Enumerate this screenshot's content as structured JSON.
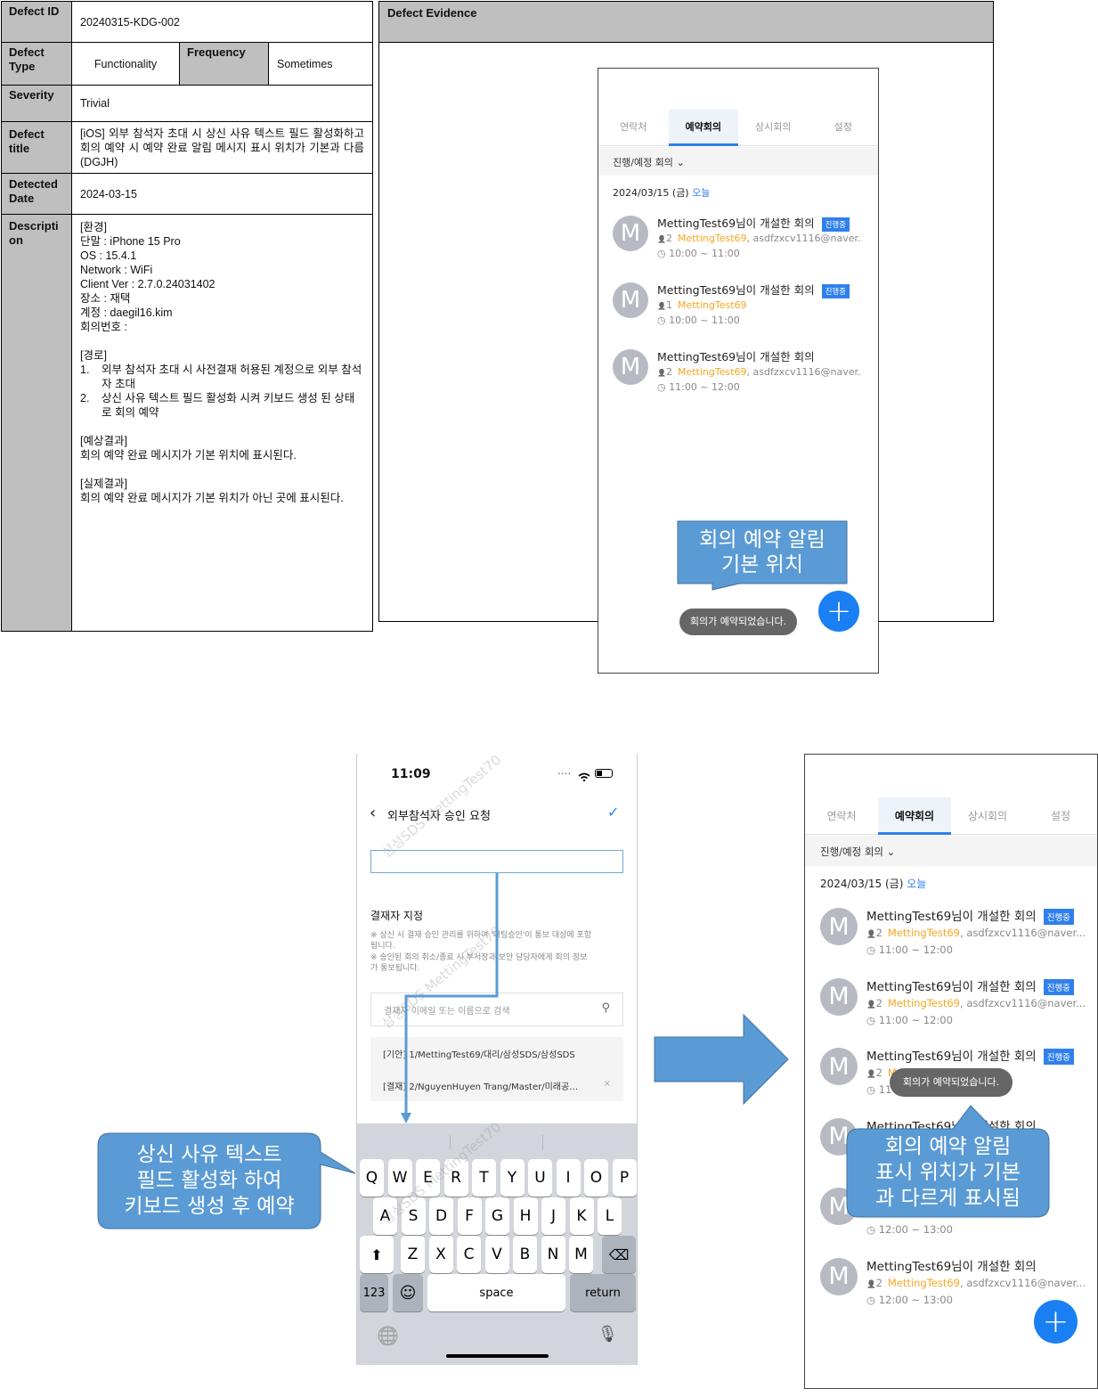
{
  "table": {
    "labels": {
      "defect_id": "Defect ID",
      "defect_type": "Defect Type",
      "frequency": "Frequency",
      "severity": "Severity",
      "defect_title": "Defect title",
      "detected_date": "Detected Date",
      "description": "Description"
    },
    "values": {
      "defect_id": "20240315-KDG-002",
      "defect_type": "Functionality",
      "frequency": "Sometimes",
      "severity": "Trivial",
      "defect_title": "[iOS] 외부 참석자 초대 시 상신 사유 텍스트 필드 활성화하고 회의 예약 시 예약 완료 알림 메시지 표시 위치가 기본과 다름 (DGJH)",
      "detected_date": "2024-03-15"
    },
    "description": {
      "env": [
        "[환경]",
        "단말 : iPhone 15 Pro",
        "OS : 15.4.1",
        "Network : WiFi",
        "Client Ver : 2.7.0.24031402",
        "장소 : 재택",
        "계정 : daegil16.kim",
        "회의번호 :"
      ],
      "path_header": "[경로]",
      "steps": [
        "외부 참석자 초대 시 사전결재 허용된 계정으로 외부 참석자 초대",
        "상신 사유 텍스트 필드 활성화 시켜 키보드 생성 된 상태로 회의 예약"
      ],
      "expected_header": "[예상결과]",
      "expected": "회의 예약 완료 메시지가 기본 위치에 표시된다.",
      "actual_header": "[실제결과]",
      "actual": "회의 예약 완료 메시지가 기본 위치가 아닌 곳에 표시된다."
    }
  },
  "evidence": {
    "title": "Defect Evidence"
  },
  "app": {
    "tabs": [
      "연락처",
      "예약회의",
      "상시회의",
      "설정"
    ],
    "filter": "진행/예정 회의",
    "date": "2024/03/15 (금)",
    "today": "오늘",
    "badge": "진행중",
    "toast": "회의가 예약되었습니다.",
    "fab": "+",
    "avatar": "M",
    "top_meetings": [
      {
        "title": "MettingTest69님이 개설한 회의",
        "count": "2",
        "host": "MettingTest69",
        "others": ", asdfzxcv1116@naver....",
        "time": "10:00 ~ 11:00",
        "badge": true
      },
      {
        "title": "MettingTest69님이 개설한 회의",
        "count": "1",
        "host": "MettingTest69",
        "others": "",
        "time": "10:00 ~ 11:00",
        "badge": true
      },
      {
        "title": "MettingTest69님이 개설한 회의",
        "count": "2",
        "host": "MettingTest69",
        "others": ", asdfzxcv1116@naver....",
        "time": "11:00 ~ 12:00",
        "badge": false
      }
    ],
    "right_meetings": [
      {
        "title": "MettingTest69님이 개설한 회의",
        "count": "2",
        "host": "MettingTest69",
        "others": ", asdfzxcv1116@naver....",
        "time": "11:00 ~ 12:00",
        "badge": true
      },
      {
        "title": "MettingTest69님이 개설한 회의",
        "count": "2",
        "host": "MettingTest69",
        "others": ", asdfzxcv1116@naver....",
        "time": "11:00 ~ 12:00",
        "badge": true
      },
      {
        "title": "MettingTest69님이 개설한 회의",
        "count": "2",
        "host": "M",
        "others": "est70",
        "time": "11",
        "badge": true
      },
      {
        "title": "MettingTest69님이 개설한 회의",
        "count": "",
        "host": "",
        "others": "ver....",
        "time": "",
        "badge": false
      },
      {
        "title": "",
        "count": "",
        "host": "",
        "others": "ver....",
        "time": "12:00 ~ 13:00",
        "badge": false
      },
      {
        "title": "MettingTest69님이 개설한 회의",
        "count": "2",
        "host": "MettingTest69",
        "others": ", asdfzxcv1116@naver....",
        "time": "12:00 ~ 13:00",
        "badge": false
      }
    ]
  },
  "callouts": {
    "default_position": "회의 예약 알림\n기본 위치",
    "keyboard": "상신 사유 텍스트\n필드 활성화 하여\n키보드 생성 후 예약",
    "wrong_position": "회의 예약 알림\n표시 위치가 기본\n과 다르게 표시됨"
  },
  "ios": {
    "time": "11:09",
    "signal": "....",
    "nav_title": "외부참석자 승인 요청",
    "approver_title": "결재자 지정",
    "notice1": "※ 상신 시 결재 승인 관리를 위하여 '미팅승인'이 통보 대상에 포함됩니다.",
    "notice2": "※ 승인된 회의 취소/종료 시 부서장과 보안 담당자에게 회의 정보가 통보됩니다.",
    "search_placeholder": "결재자 이메일 또는 이름으로 검색",
    "approvers": [
      "[기안] 1/MettingTest69/대리/삼성SDS/삼성SDS",
      "[결재] 2/NguyenHuyen Trang/Master/미래공…"
    ],
    "remove": "×",
    "watermark": "삼성SDS MettingTest70",
    "keys_row1": [
      "Q",
      "W",
      "E",
      "R",
      "T",
      "Y",
      "U",
      "I",
      "O",
      "P"
    ],
    "keys_row2": [
      "A",
      "S",
      "D",
      "F",
      "G",
      "H",
      "J",
      "K",
      "L"
    ],
    "keys_row3": [
      "Z",
      "X",
      "C",
      "V",
      "B",
      "N",
      "M"
    ],
    "key_123": "123",
    "key_space": "space",
    "key_return": "return",
    "key_shift": "⬆",
    "key_delete": "⌫",
    "key_emoji": "☺",
    "key_globe": "🌐",
    "key_mic": "🎙"
  },
  "colors": {
    "accent": "#2f80ed",
    "host": "#f5a623",
    "callout": "#5b9bd5",
    "fab": "#1a7ff2",
    "label_bg": "#bfbfbf"
  }
}
